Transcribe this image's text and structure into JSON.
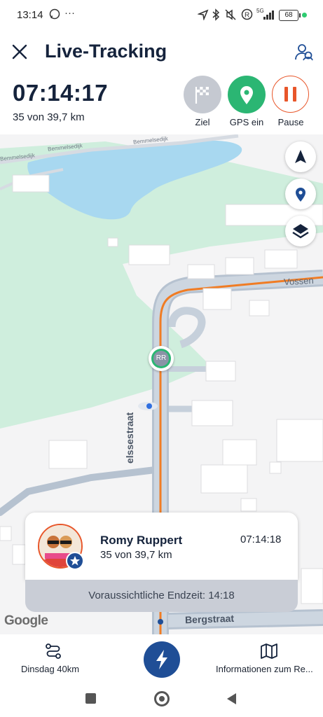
{
  "status_bar": {
    "time": "13:14",
    "overflow": "···",
    "network": "5G",
    "battery": "68",
    "icons": [
      "whatsapp-icon",
      "location-arrow-icon",
      "bluetooth-icon",
      "mute-icon",
      "registered-icon",
      "signal-icon"
    ]
  },
  "header": {
    "title": "Live-Tracking",
    "elapsed": "07:14:17",
    "progress": "35 von 39,7 km",
    "actions": [
      {
        "label": "Ziel",
        "icon": "checkered-flag-icon",
        "color": "#c5c9d1"
      },
      {
        "label": "GPS ein",
        "icon": "map-pin-icon",
        "color": "#2bb673"
      },
      {
        "label": "Pause",
        "icon": "pause-icon",
        "color": "#e8562a"
      }
    ]
  },
  "map": {
    "streets": {
      "vossen": "Vossen",
      "bemmel1": "Bemmelsedijk",
      "bemmel2": "Bemmelsedijk",
      "bemmel3": "Bemmelsedijk",
      "vertical": "elssestraat",
      "berg": "Bergstraat"
    },
    "marker_initials": "RR",
    "attribution": "Google",
    "colors": {
      "route": "#f07c24",
      "water": "#a8d8f0",
      "park": "#cfeedd",
      "road": "#b6c2d0"
    }
  },
  "participant": {
    "name": "Romy Ruppert",
    "progress": "35 von 39,7 km",
    "time": "07:14:18",
    "eta": "Voraussichtliche Endzeit: 14:18"
  },
  "bottom_nav": {
    "left_label": "Dinsdag 40km",
    "right_label": "Informationen zum Re...",
    "accent": "#1f4e96"
  }
}
